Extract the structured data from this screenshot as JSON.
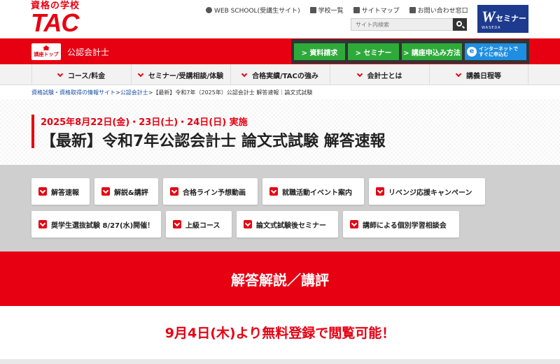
{
  "header": {
    "logo_sub": "資格の学校",
    "logo_main": "TAC",
    "links": [
      "WEB SCHOOL(受講生サイト)",
      "学校一覧",
      "サイトマップ",
      "お問い合わせ窓口"
    ],
    "search_placeholder": "サイト内検索",
    "waseda_w": "W",
    "waseda_label": "セミナー",
    "waseda_sub": "WASEDA"
  },
  "redbar": {
    "home_label": "講座トップ",
    "site_title": "公認会計士",
    "cta": [
      "> 資料請求",
      "> セミナー",
      "> 講座申込み方法"
    ],
    "internet_line1": "インターネットで",
    "internet_line2": "すぐに申込む",
    "internet_icon": "e"
  },
  "nav": [
    "コース/料金",
    "セミナー/受講相談/体験",
    "合格実績/TACの強み",
    "会計士とは",
    "講義日程等"
  ],
  "breadcrumb": {
    "link1": "資格試験・資格取得の情報サイト",
    "sep1": ">",
    "link2": "公認会計士",
    "rest": ">【最新】令和7年（2025年）公認会計士 解答速報｜論文式試験"
  },
  "hero": {
    "date": "2025年8月22日(金)・23日(土)・24日(日) 実施",
    "title": "【最新】令和7年公認会計士 論文式試験 解答速報"
  },
  "links": [
    "解答速報",
    "解説&講評",
    "合格ライン予想動画",
    "就職活動イベント案内",
    "リベンジ応援キャンペーン",
    "奨学生選抜試験 8/27(水)開催！",
    "上級コース",
    "論文式試験後セミナー",
    "講師による個別学習相談会"
  ],
  "banner": "解答解説／講評",
  "notice": "9月4日(木)より無料登録で閲覧可能！",
  "colors": {
    "brand_red": "#e60012",
    "cta_green": "#2eaa3a",
    "cta_blue": "#1f8ee0",
    "waseda_blue": "#1d3a8f"
  }
}
